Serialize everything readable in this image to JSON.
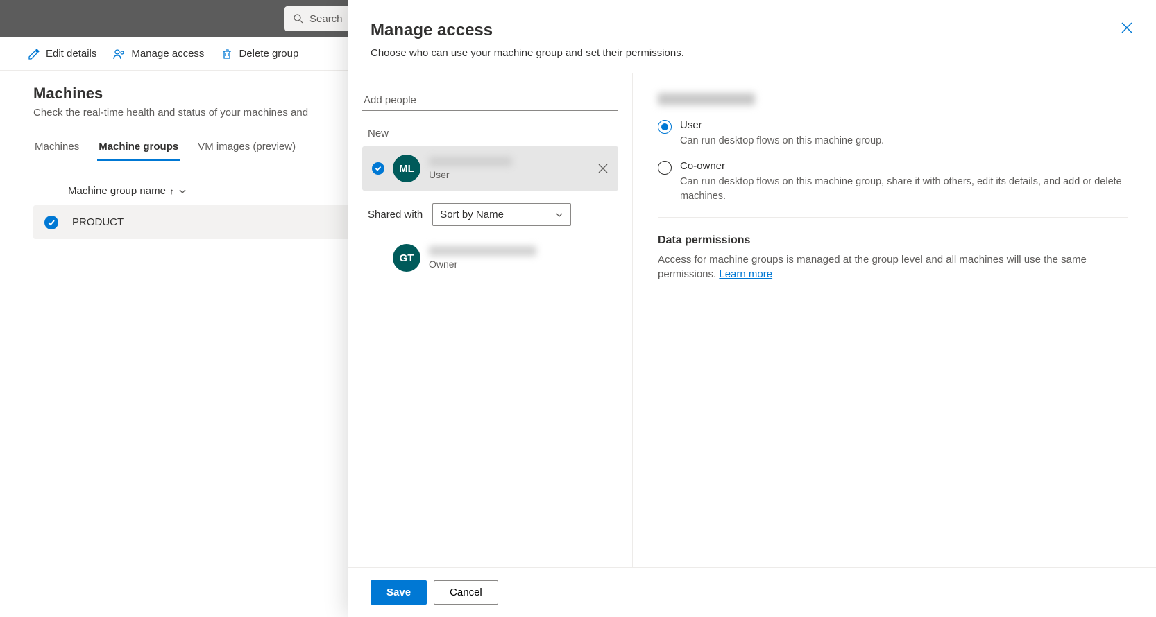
{
  "topbar": {
    "search_placeholder": "Search"
  },
  "commandBar": {
    "edit_details": "Edit details",
    "manage_access": "Manage access",
    "delete_group": "Delete group"
  },
  "page": {
    "title": "Machines",
    "subtitle": "Check the real-time health and status of your machines and"
  },
  "tabs": {
    "machines": "Machines",
    "machine_groups": "Machine groups",
    "vm_images": "VM images (preview)"
  },
  "table": {
    "col_name": "Machine group name",
    "row0": {
      "name": "PRODUCT"
    }
  },
  "panel": {
    "title": "Manage access",
    "subtitle": "Choose who can use your machine group and set their permissions.",
    "add_people_placeholder": "Add people",
    "section_new": "New",
    "people": {
      "new0": {
        "initials": "ML",
        "role": "User"
      },
      "shared0": {
        "initials": "GT",
        "role": "Owner"
      }
    },
    "shared_with_label": "Shared with",
    "sort_label": "Sort by Name",
    "permissions": {
      "user": {
        "label": "User",
        "desc": "Can run desktop flows on this machine group."
      },
      "coowner": {
        "label": "Co-owner",
        "desc": "Can run desktop flows on this machine group, share it with others, edit its details, and add or delete machines."
      }
    },
    "data_perm": {
      "title": "Data permissions",
      "text": "Access for machine groups is managed at the group level and all machines will use the same permissions. ",
      "link": "Learn more"
    },
    "footer": {
      "save": "Save",
      "cancel": "Cancel"
    }
  }
}
